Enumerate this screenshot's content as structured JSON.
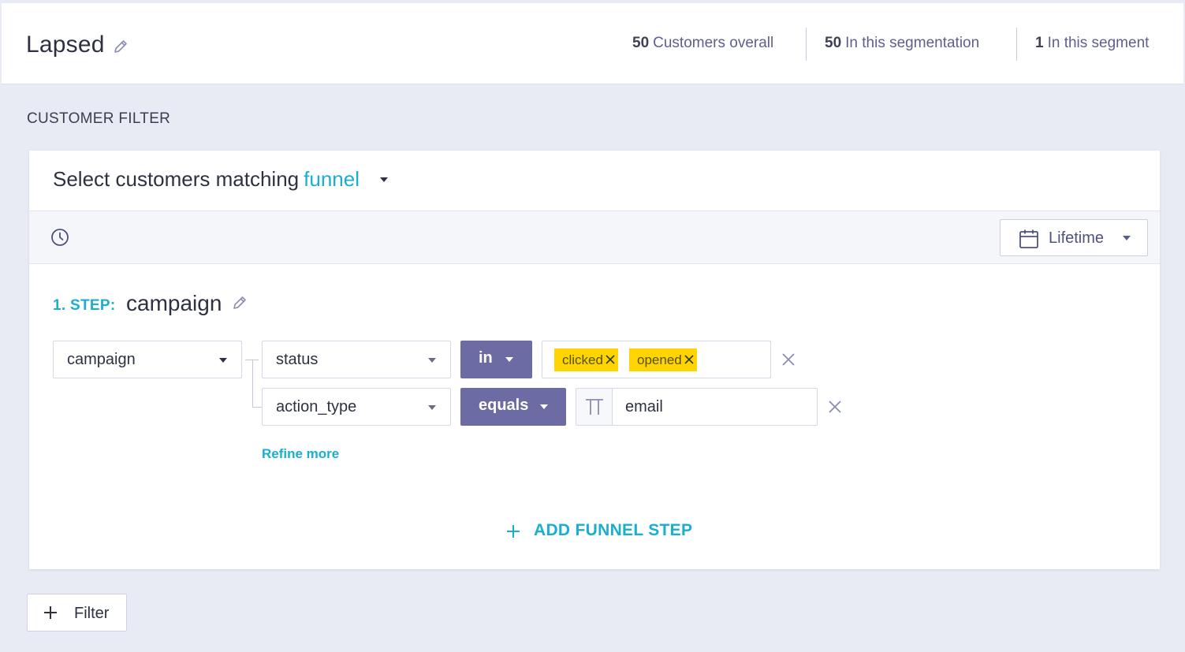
{
  "header": {
    "title": "Lapsed",
    "stats": [
      {
        "count": "50",
        "label": "Customers overall"
      },
      {
        "count": "50",
        "label": "In this segmentation"
      },
      {
        "count": "1",
        "label": "In this segment"
      }
    ]
  },
  "filter": {
    "section_label": "CUSTOMER FILTER",
    "match_prefix": "Select customers matching",
    "match_mode": "funnel",
    "time_range": "Lifetime",
    "step": {
      "number_label": "1. STEP:",
      "name": "campaign",
      "event": "campaign",
      "conditions": [
        {
          "property": "status",
          "operator": "in",
          "values": [
            "clicked",
            "opened"
          ]
        },
        {
          "property": "action_type",
          "operator": "equals",
          "value": "email"
        }
      ],
      "refine_label": "Refine more"
    },
    "add_step_label": "ADD FUNNEL STEP",
    "add_filter_label": "Filter"
  },
  "colors": {
    "accent": "#1aaed0",
    "operator_bg": "#6c6ba3",
    "chip_bg": "#ffd400"
  }
}
